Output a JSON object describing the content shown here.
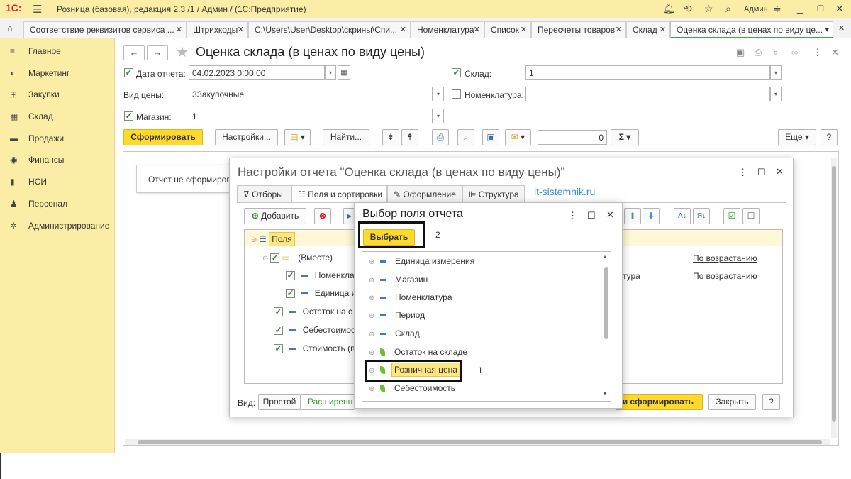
{
  "window": {
    "logo": "1С:",
    "title": "Розница (базовая), редакция 2.3 /1 / Админ /  (1С:Предприятие)",
    "user": "Админ"
  },
  "tabs": [
    {
      "label": "Соответствие реквизитов сервиса ..."
    },
    {
      "label": "Штрихкоды"
    },
    {
      "label": "C:\\Users\\User\\Desktop\\скрины\\Спи..."
    },
    {
      "label": "Номенклатура"
    },
    {
      "label": "Список"
    },
    {
      "label": "Пересчеты товаров"
    },
    {
      "label": "Склад"
    },
    {
      "label": "Оценка склада (в ценах по виду це..."
    }
  ],
  "sidebar": {
    "items": [
      {
        "label": "Главное",
        "icon": "≡"
      },
      {
        "label": "Маркетинг",
        "icon": "◐"
      },
      {
        "label": "Закупки",
        "icon": "⊞"
      },
      {
        "label": "Склад",
        "icon": "▦"
      },
      {
        "label": "Продажи",
        "icon": "▬"
      },
      {
        "label": "Финансы",
        "icon": "◉"
      },
      {
        "label": "НСИ",
        "icon": "▮"
      },
      {
        "label": "Персонал",
        "icon": "♟"
      },
      {
        "label": "Администрирование",
        "icon": "✲"
      }
    ]
  },
  "form": {
    "title": "Оценка склада (в ценах по виду цены)",
    "report_date_label": "Дата отчета:",
    "report_date_value": "04.02.2023  0:00:00",
    "warehouse_label": "Склад:",
    "warehouse_value": "1",
    "price_type_label": "Вид цены:",
    "price_type_value": "3Закупочные",
    "nomenclature_label": "Номенклатура:",
    "nomenclature_value": "",
    "store_label": "Магазин:",
    "store_value": "1",
    "generate_button": "Сформировать",
    "settings_button": "Настройки...",
    "find_button": "Найти...",
    "sum_value": "0",
    "more_button": "Еще",
    "help_button": "?",
    "report_not_formed": "Отчет не сформирован"
  },
  "settings_dialog": {
    "title": "Настройки отчета \"Оценка склада (в ценах по виду цены)\"",
    "tabs": [
      "Отборы",
      "Поля и сортировки",
      "Оформление",
      "Структура"
    ],
    "site": "it-sistemnik.ru",
    "add_button": "Добавить",
    "tree": [
      {
        "label": "Поля"
      },
      {
        "label": "(Вместе)"
      },
      {
        "label": "Номенкла"
      },
      {
        "label": "Единица и"
      },
      {
        "label": "Остаток на с"
      },
      {
        "label": "Себестоимос"
      },
      {
        "label": "Стоимость (п"
      }
    ],
    "right_fragment": "тура",
    "sort_links": [
      "По возрастанию",
      "По возрастанию"
    ],
    "view_label": "Вид:",
    "view_simple": "Простой",
    "view_extended": "Расширенн",
    "close_and_generate": "и сформировать",
    "close_button": "Закрыть",
    "help_button": "?"
  },
  "select_dialog": {
    "title": "Выбор поля отчета",
    "select_button": "Выбрать",
    "annotation_2": "2",
    "annotation_1": "1",
    "items": [
      {
        "label": "Единица измерения",
        "kind": "dimension"
      },
      {
        "label": "Магазин",
        "kind": "dimension"
      },
      {
        "label": "Номенклатура",
        "kind": "dimension"
      },
      {
        "label": "Период",
        "kind": "dimension"
      },
      {
        "label": "Склад",
        "kind": "dimension"
      },
      {
        "label": "Остаток на складе",
        "kind": "resource"
      },
      {
        "label": "Розничная цена",
        "kind": "resource"
      },
      {
        "label": "Себестоимость",
        "kind": "resource"
      }
    ]
  },
  "colors": {
    "sidebar_bg": "#fbeda5",
    "accent_yellow": "#ffd92b",
    "active_tab_underline": "#3fa34d",
    "link_blue": "#3a8fd0"
  }
}
